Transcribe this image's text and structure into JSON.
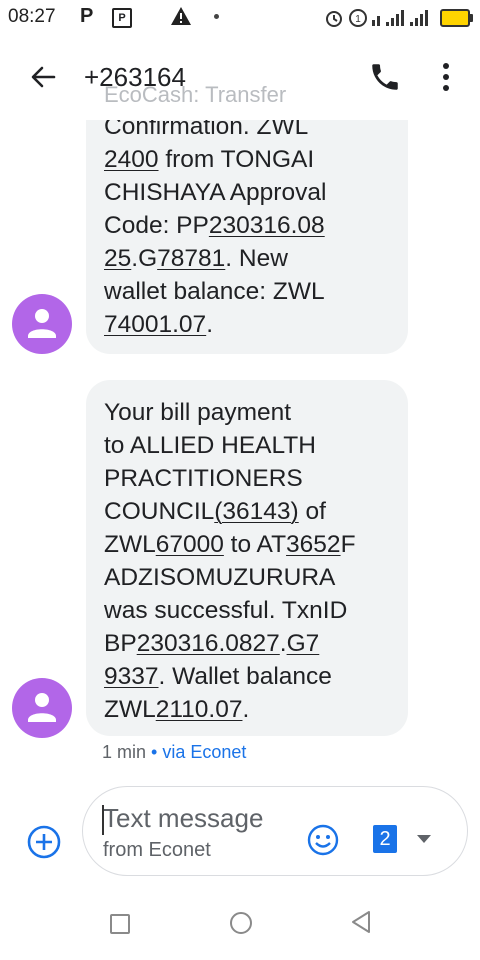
{
  "status_bar": {
    "time": "08:27",
    "icons": [
      "p-icon",
      "parking-icon",
      "warning-icon",
      "dot-icon",
      "alarm-icon",
      "sim-icon",
      "signal-icon",
      "battery-icon"
    ]
  },
  "header": {
    "title": "+263164",
    "obscured_text": "EcoCash: Transfer"
  },
  "messages": [
    {
      "segments": [
        {
          "t": "Confirmation. ZWL\n"
        },
        {
          "t": "2400",
          "u": true
        },
        {
          "t": " from TONGAI\nCHISHAYA Approval\nCode: PP"
        },
        {
          "t": "230316.08",
          "u": true
        },
        {
          "t": "\n"
        },
        {
          "t": "25",
          "u": true
        },
        {
          "t": ".G"
        },
        {
          "t": "78781",
          "u": true
        },
        {
          "t": ". New\nwallet balance: ZWL\n"
        },
        {
          "t": "74001.07",
          "u": true
        },
        {
          "t": "."
        }
      ]
    },
    {
      "segments": [
        {
          "t": "Your bill payment\nto ALLIED HEALTH\nPRACTITIONERS\nCOUNCIL"
        },
        {
          "t": "(36143)",
          "u": true
        },
        {
          "t": " of\nZWL"
        },
        {
          "t": "67000",
          "u": true
        },
        {
          "t": " to AT"
        },
        {
          "t": "3652",
          "u": true
        },
        {
          "t": "F\nADZISOMUZURURA\nwas successful. TxnID\nBP"
        },
        {
          "t": "230316.0827",
          "u": true
        },
        {
          "t": "."
        },
        {
          "t": "G7",
          "u": true
        },
        {
          "t": "\n"
        },
        {
          "t": "9337",
          "u": true
        },
        {
          "t": ". Wallet balance\nZWL"
        },
        {
          "t": "2110.07",
          "u": true
        },
        {
          "t": "."
        }
      ]
    }
  ],
  "meta": {
    "time": "1 min",
    "separator": "•",
    "via": "via Econet"
  },
  "compose": {
    "placeholder": "Text message",
    "sub_label": "from Econet",
    "sim_number": "2"
  },
  "colors": {
    "avatar": "#b266e8",
    "bubble": "#f1f3f4",
    "accent": "#1a73e8"
  }
}
